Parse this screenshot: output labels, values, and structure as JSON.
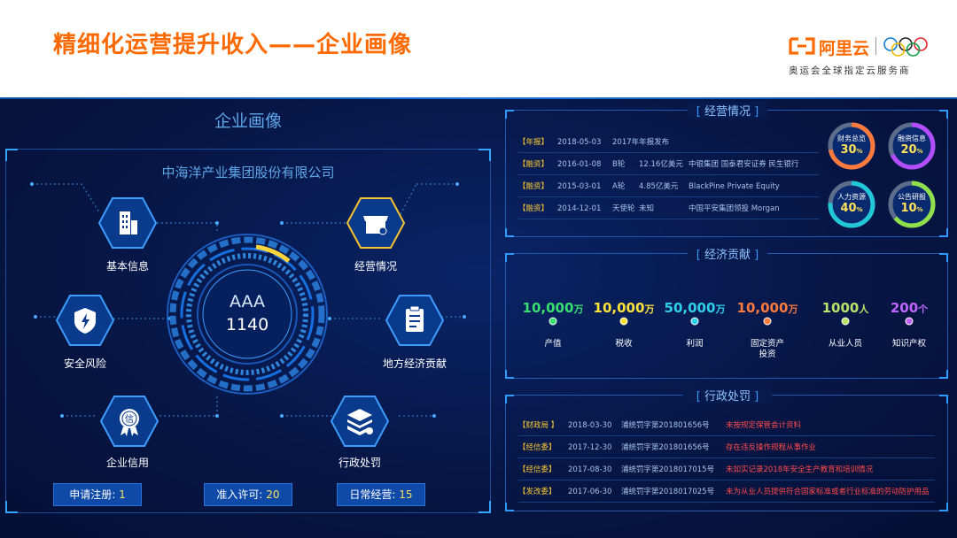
{
  "header": {
    "title": "精细化运营提升收入——企业画像",
    "logo_text": "阿里云",
    "logo_sub": "奥运会全球指定云服务商"
  },
  "left": {
    "section_title": "企业画像",
    "company": "中海洋产业集团股份有限公司",
    "gauge": {
      "grade": "AAA",
      "score": "1140"
    },
    "nodes": [
      {
        "label": "基本信息",
        "icon": "building-icon"
      },
      {
        "label": "经营情况",
        "icon": "store-icon"
      },
      {
        "label": "安全风险",
        "icon": "shield-bolt-icon"
      },
      {
        "label": "地方经济贡献",
        "icon": "clipboard-icon"
      },
      {
        "label": "企业信用",
        "icon": "credit-badge-icon"
      },
      {
        "label": "行政处罚",
        "icon": "stack-icon"
      }
    ],
    "stats": [
      {
        "label": "申请注册:",
        "value": "1"
      },
      {
        "label": "准入许可:",
        "value": "20"
      },
      {
        "label": "日常经营:",
        "value": "15"
      }
    ]
  },
  "operations": {
    "title": "经营情况",
    "rows": [
      {
        "tag": "【年报】",
        "date": "2018-05-03",
        "c1": "2017年年报发布",
        "c2": "",
        "c3": ""
      },
      {
        "tag": "【融资】",
        "date": "2016-01-08",
        "c1": "B轮",
        "c2": "12.16亿美元",
        "c3": "中银集团  国泰君安证券  民生银行"
      },
      {
        "tag": "【融资】",
        "date": "2015-03-01",
        "c1": "A轮",
        "c2": "4.85亿美元",
        "c3": "BlackPine Private Equity"
      },
      {
        "tag": "【融资】",
        "date": "2014-12-01",
        "c1": "天使轮",
        "c2": "未知",
        "c3": "中国平安集团领投   Morgan"
      }
    ],
    "rings": [
      {
        "label": "财务总览",
        "value": "30",
        "unit": "%",
        "percent": 30,
        "color": "#ff7a3d"
      },
      {
        "label": "融资信息",
        "value": "20",
        "unit": "%",
        "percent": 20,
        "color": "#b44dff"
      },
      {
        "label": "人力资源",
        "value": "40",
        "unit": "%",
        "percent": 40,
        "color": "#22c8d8"
      },
      {
        "label": "公告研报",
        "value": "10",
        "unit": "%",
        "percent": 10,
        "color": "#8fe04a"
      }
    ]
  },
  "economy": {
    "title": "经济贡献",
    "items": [
      {
        "value": "10,000",
        "unit": "万",
        "label": "产值",
        "color": "#39e06f"
      },
      {
        "value": "10,000",
        "unit": "万",
        "label": "税收",
        "color": "#ffe23a"
      },
      {
        "value": "50,000",
        "unit": "万",
        "label": "利润",
        "color": "#2fd0ea"
      },
      {
        "value": "10,000",
        "unit": "万",
        "label": "固定资产\n投资",
        "color": "#ff7a3d"
      },
      {
        "value": "1000",
        "unit": "人",
        "label": "从业人员",
        "color": "#b7e56a"
      },
      {
        "value": "200",
        "unit": "个",
        "label": "知识产权",
        "color": "#c065ff"
      }
    ]
  },
  "penalty": {
    "title": "行政处罚",
    "rows": [
      {
        "tag": "【财政局 】",
        "date": "2018-03-30",
        "code": "浦统罚字第201801656号",
        "desc": "未按规定保管会计资料"
      },
      {
        "tag": "【经信委】",
        "date": "2017-12-30",
        "code": "浦统罚字第201801656号",
        "desc": "存在违反操作规程从事作业"
      },
      {
        "tag": "【经信委】",
        "date": "2017-08-30",
        "code": "浦统罚字第2018017015号",
        "desc": "未如实记录2018年安全生产教育和培训情况"
      },
      {
        "tag": "【发改委】",
        "date": "2017-06-30",
        "code": "浦统罚字第2018017025号",
        "desc": "未为从业人员提供符合国家标准或者行业标准的劳动防护用品"
      }
    ]
  }
}
